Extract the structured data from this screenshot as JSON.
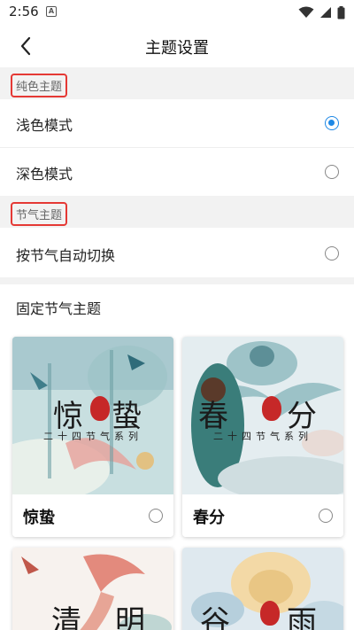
{
  "status_bar": {
    "time": "2:56",
    "notification": "A"
  },
  "header": {
    "title": "主题设置"
  },
  "solid_section": {
    "label": "纯色主题",
    "items": [
      {
        "label": "浅色模式",
        "selected": true
      },
      {
        "label": "深色模式",
        "selected": false
      }
    ]
  },
  "solar_section": {
    "label": "节气主题",
    "items": [
      {
        "label": "按节气自动切换",
        "selected": false
      }
    ]
  },
  "fixed_section": {
    "title": "固定节气主题",
    "cards": [
      {
        "name": "惊蛰",
        "art_char_1": "惊",
        "art_char_2": "蛰",
        "subtitle": "二十四节气系列",
        "selected": false
      },
      {
        "name": "春分",
        "art_char_1": "春",
        "art_char_2": "分",
        "subtitle": "二十四节气系列",
        "selected": false
      },
      {
        "art_char_1": "清",
        "art_char_2": "明"
      },
      {
        "art_char_1": "谷",
        "art_char_2": "雨"
      }
    ]
  },
  "colors": {
    "accent": "#1e88e5",
    "highlight_border": "#e53935",
    "seal_red": "#c62828"
  }
}
